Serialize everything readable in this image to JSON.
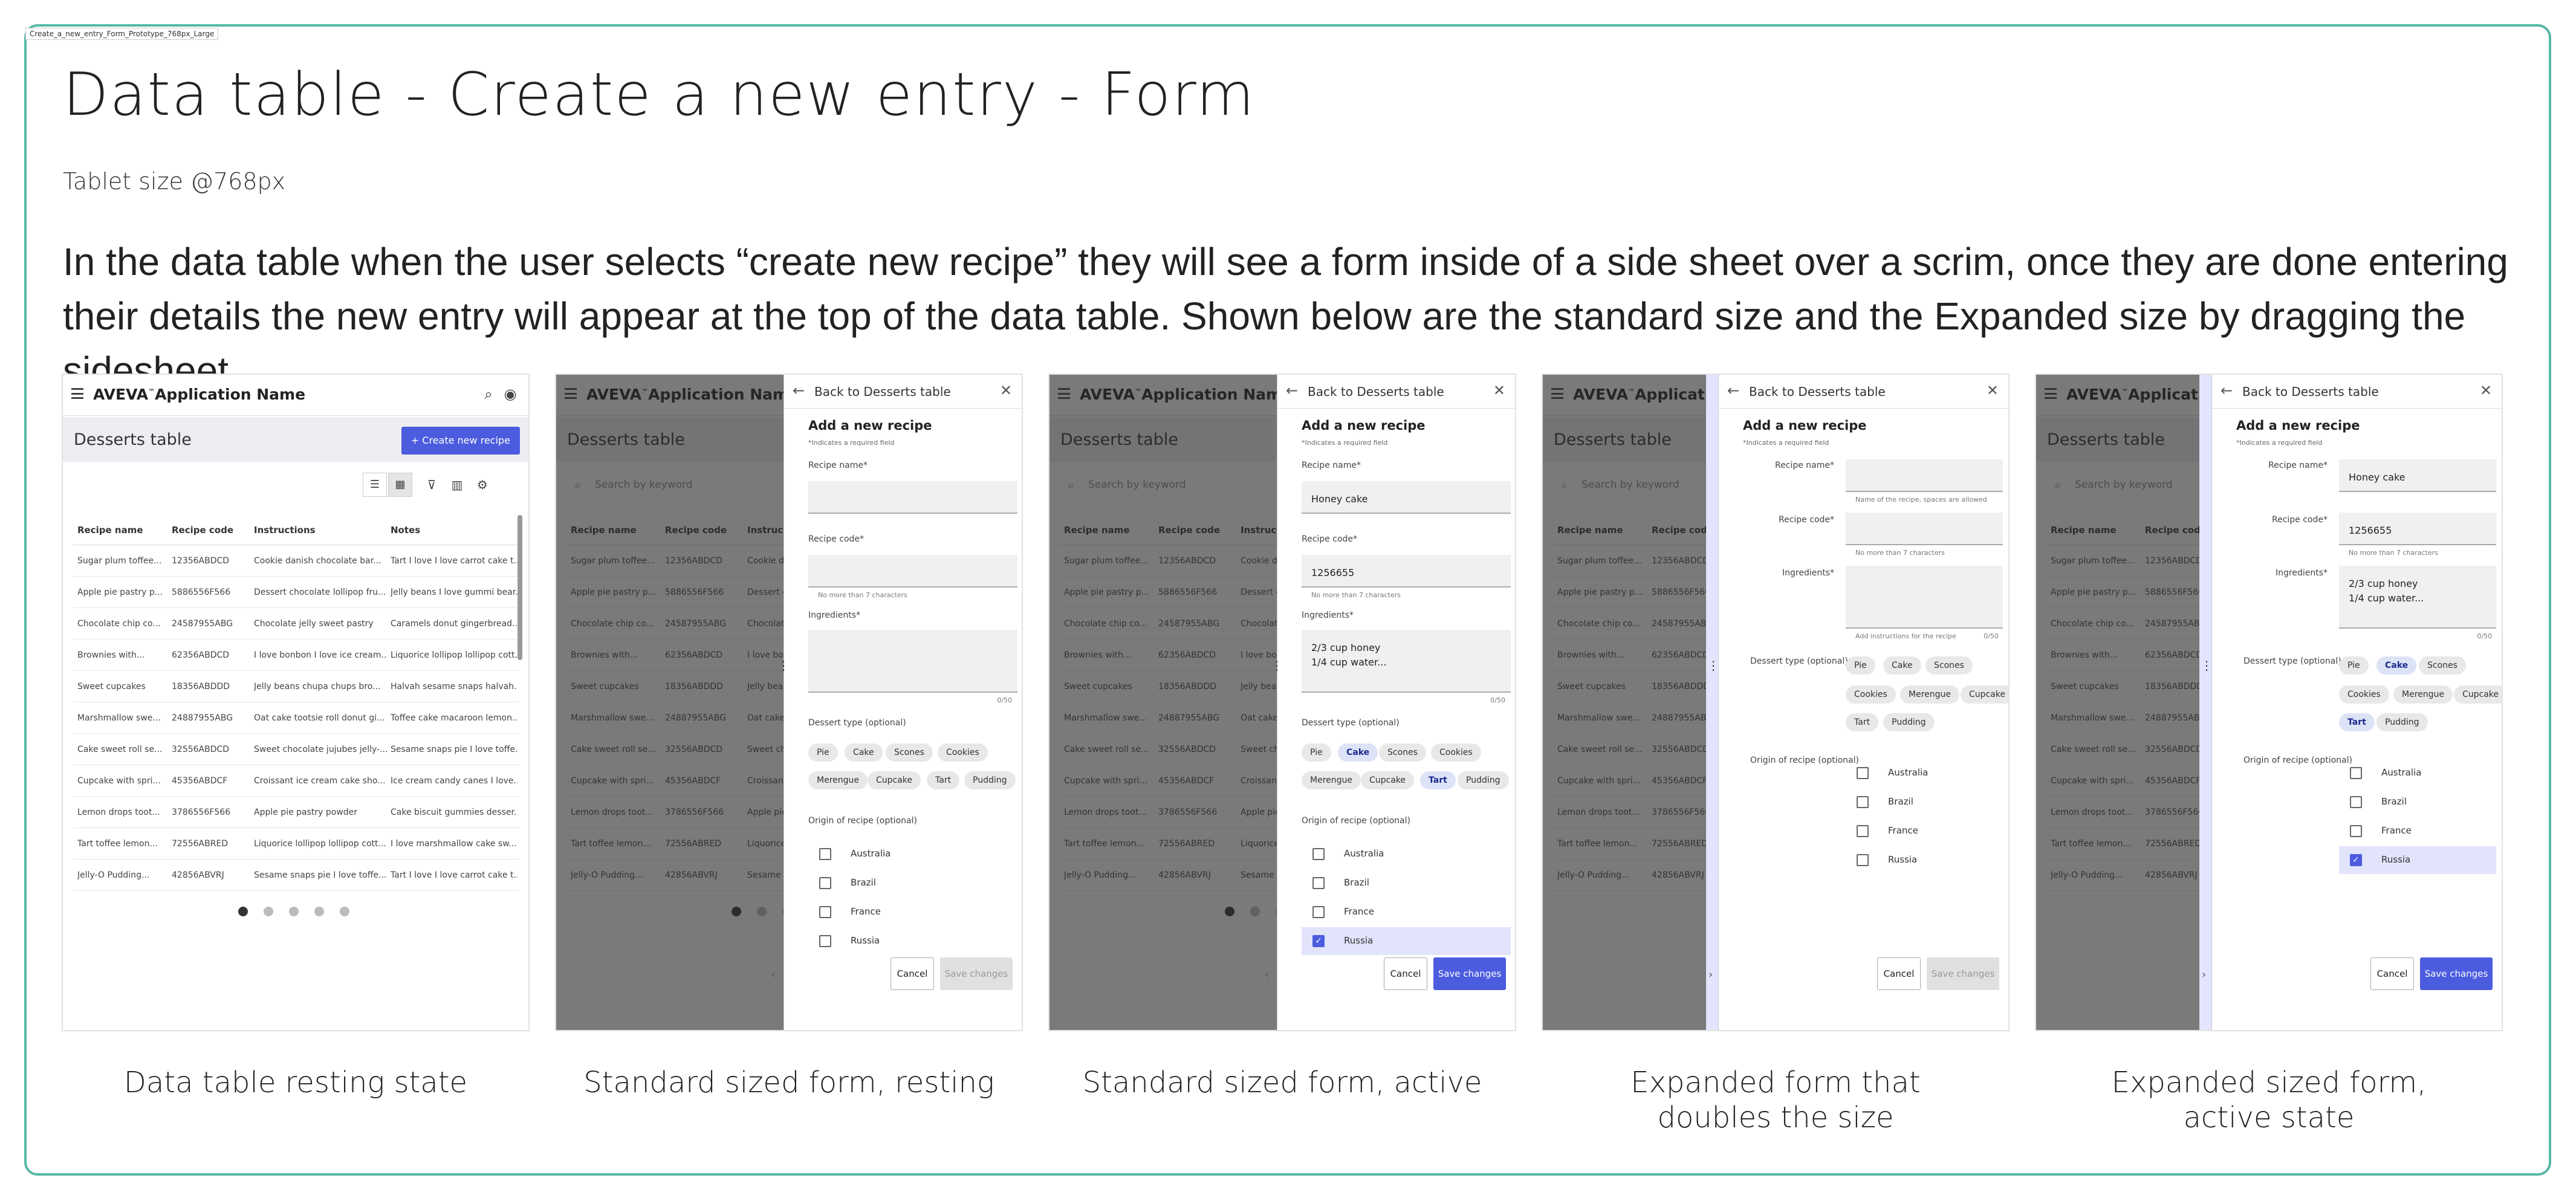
{
  "frame_label": "Create_a_new_entry_Form_Prototype_768px_Large",
  "title": "Data table - Create a new entry - Form",
  "subtitle": "Tablet size @768px",
  "description": "In the data table when the user selects “create new recipe” they will see a form inside of a side sheet over a scrim, once they are done entering their details the new entry will appear at the top of the data table. Shown below are the standard size and the Expanded size by dragging the sidesheet.",
  "captions": [
    "Data table resting state",
    "Standard sized form, resting",
    "Standard sized form, active",
    "Expanded form that doubles the size",
    "Expanded sized form, active state"
  ],
  "app": {
    "brand": "AVEVA",
    "brand_mark": "™",
    "app_name": "Application Name",
    "page_title": "Desserts table",
    "create_button": "Create new recipe",
    "create_button_icon": "+",
    "search_placeholder": "Search by keyword"
  },
  "table": {
    "headers": [
      "Recipe name",
      "Recipe code",
      "Instructions",
      "Notes"
    ],
    "rows": [
      [
        "Sugar plum toffee...",
        "12356ABDCD",
        "Cookie danish chocolate bar...",
        "Tart I love I love carrot cake t..."
      ],
      [
        "Apple pie pastry p...",
        "5886556F566",
        "Dessert chocolate lollipop fru...",
        "Jelly beans I love gummi bear..."
      ],
      [
        "Chocolate chip co...",
        "24587955ABG",
        "Chocolate jelly sweet pastry",
        "Caramels donut gingerbread..."
      ],
      [
        "Brownies with...",
        "62356ABDCD",
        "I love bonbon I love ice cream...",
        "Liquorice lollipop lollipop cott..."
      ],
      [
        "Sweet cupcakes",
        "18356ABDDD",
        "Jelly beans chupa chups bro...",
        "Halvah sesame snaps halvah..."
      ],
      [
        "Marshmallow swe...",
        "24887955ABG",
        "Oat cake tootsie roll donut gi...",
        "Toffee cake macaroon lemon..."
      ],
      [
        "Cake sweet roll se...",
        "32556ABDCD",
        "Sweet chocolate jujubes jelly-...",
        "Sesame snaps pie I love toffe..."
      ],
      [
        "Cupcake with spri...",
        "45356ABDCF",
        "Croissant ice cream cake sho...",
        "Ice cream candy canes I love..."
      ],
      [
        "Lemon drops toot...",
        "3786556F566",
        "Apple pie pastry powder",
        "Cake biscuit gummies desser..."
      ],
      [
        "Tart toffee lemon...",
        "72556ABRED",
        "Liquorice lollipop lollipop cott...",
        "I love marshmallow cake sw..."
      ],
      [
        "Jelly-O Pudding...",
        "42856ABVRJ",
        "Sesame snaps pie I love toffe...",
        "Tart I love I love carrot cake t..."
      ]
    ]
  },
  "form": {
    "back_label": "Back to Desserts table",
    "title": "Add a new recipe",
    "required_note": "*Indicates a required field",
    "recipe_name_label": "Recipe name*",
    "recipe_name_helper": "Name of the recipe, spaces are allowed",
    "recipe_code_label": "Recipe code*",
    "recipe_code_helper": "No more than 7 characters",
    "ingredients_label": "Ingredients*",
    "ingredients_helper": "Add instructions for the recipe",
    "counter": "0/50",
    "dessert_type_label": "Dessert type (optional)",
    "dessert_types": [
      "Pie",
      "Cake",
      "Scones",
      "Cookies",
      "Merengue",
      "Cupcake",
      "Tart",
      "Pudding"
    ],
    "origin_label": "Origin of recipe (optional)",
    "origins": [
      "Australia",
      "Brazil",
      "France",
      "Russia"
    ],
    "cancel": "Cancel",
    "save": "Save changes",
    "active_values": {
      "recipe_name": "Honey cake",
      "recipe_code": "1256655",
      "ingredients": "2/3 cup honey\n1/4 cup water..."
    }
  },
  "colors": {
    "accent": "#4b5cdf",
    "board_border": "#56b8a8",
    "scrim": "#3a3a3a"
  }
}
